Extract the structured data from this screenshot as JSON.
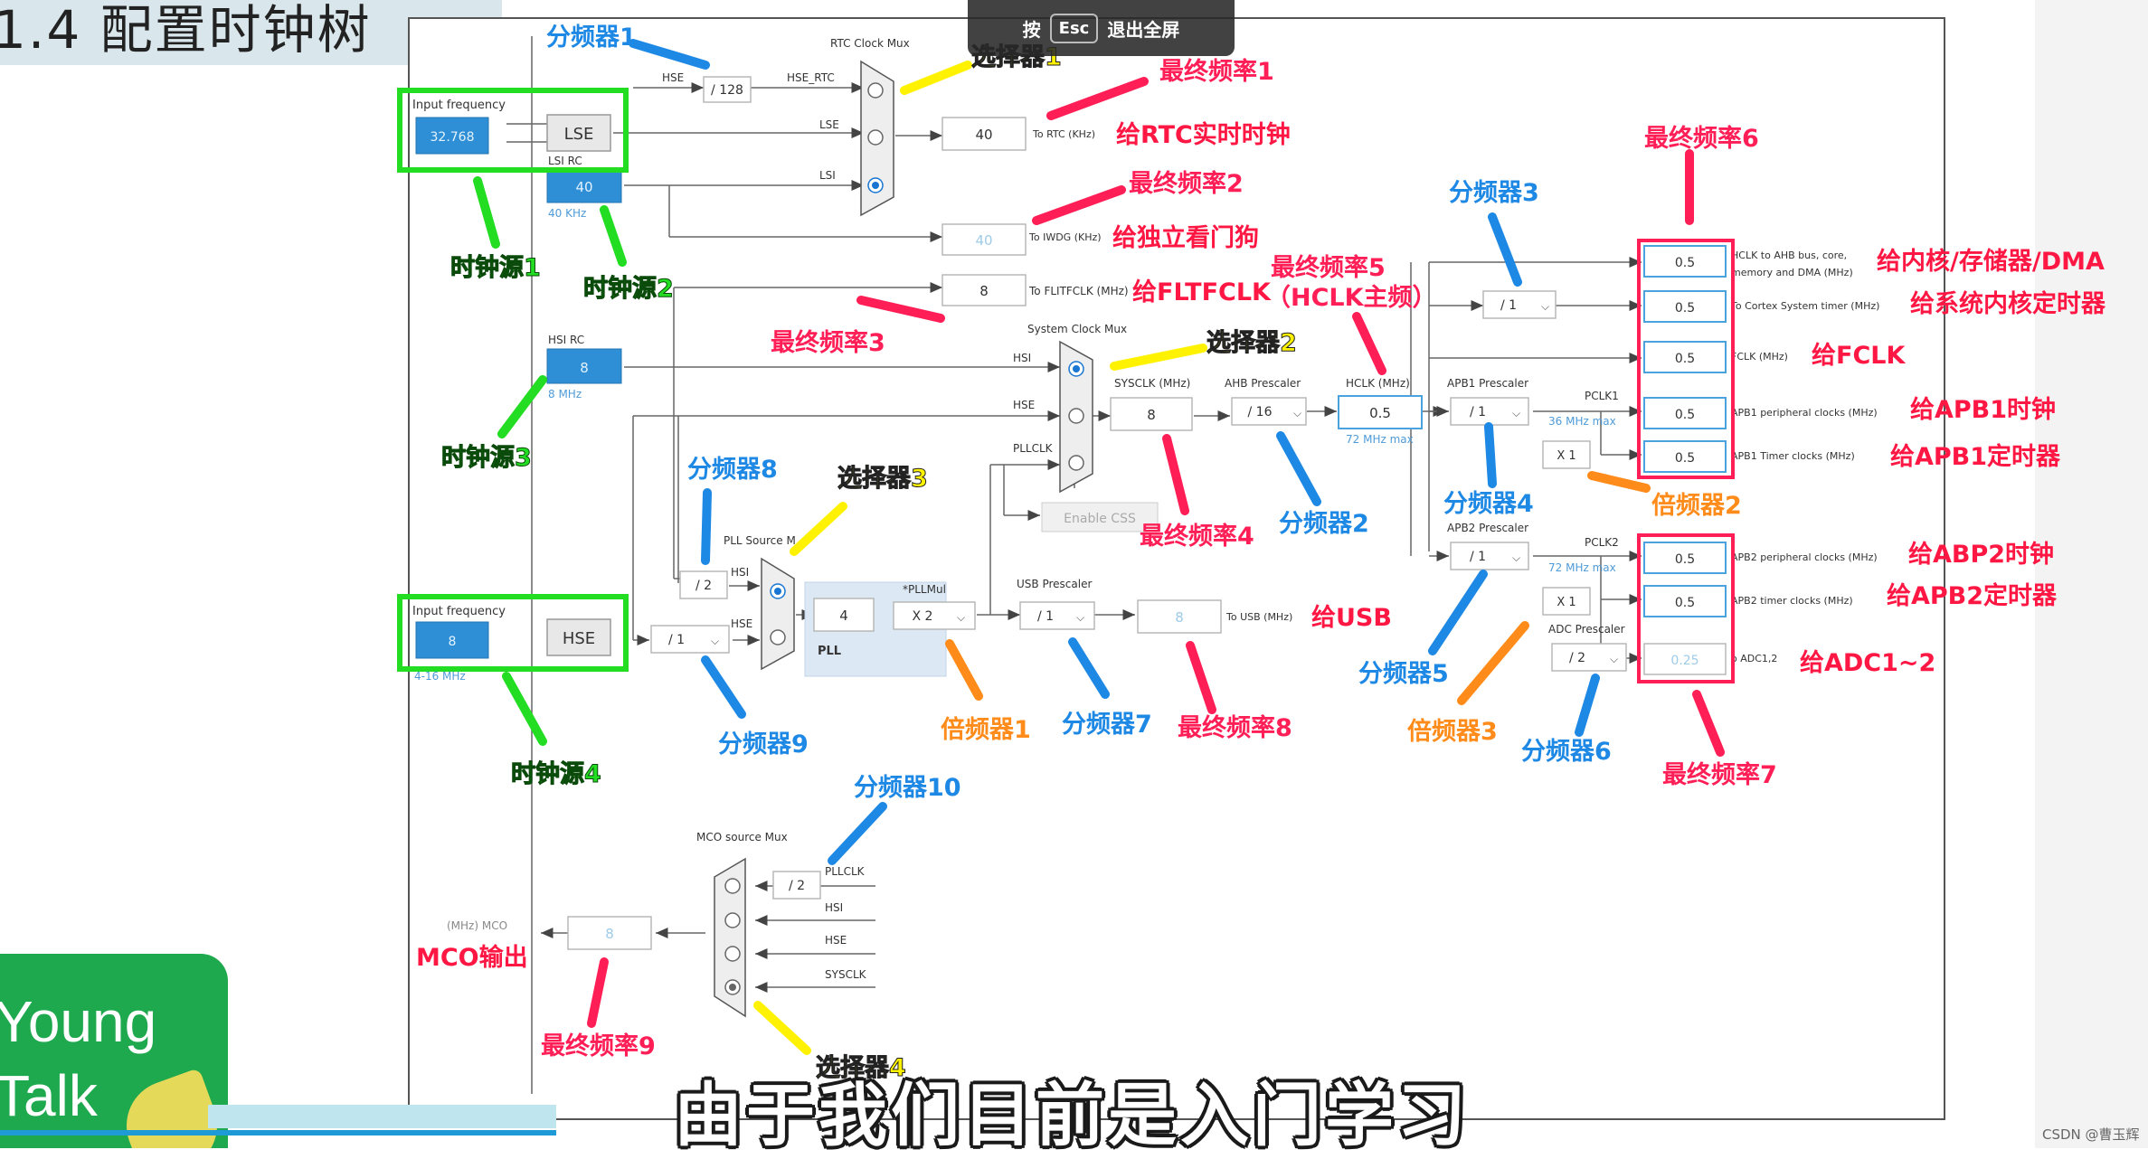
{
  "title": "1.4 配置时钟树",
  "overlay": {
    "key_label": "按",
    "key": "Esc",
    "text": "退出全屏"
  },
  "watermark": "CSDN @曹玉辉",
  "subtitle": "由于我们目前是入门学习",
  "logo": {
    "line1": "Young",
    "line2": "Talk"
  },
  "colors": {
    "green": "#22dd22",
    "red": "#ff1744",
    "blue": "#1e88e5",
    "yellow": "#fff200",
    "orange": "#ff8c1a",
    "pink": "#ff1e56",
    "source_blue": "#2e8fd6"
  },
  "diagram": {
    "input_frequency": "Input frequency",
    "lse_value": "32.768",
    "lse_label": "LSE",
    "lsi_rc": "LSI RC",
    "lsi_value": "40",
    "lsi_unit": "40 KHz",
    "hsi_rc": "HSI RC",
    "hsi_value": "8",
    "hsi_unit": "8 MHz",
    "hse_input_label": "Input frequency",
    "hse_value": "8",
    "hse_label": "HSE",
    "hse_range": "4-16 MHz",
    "rtc_mux_title": "RTC Clock Mux",
    "rtc_hse": "HSE",
    "rtc_div": "/ 128",
    "rtc_hse_rtc": "HSE_RTC",
    "rtc_lse": "LSE",
    "rtc_lsi": "LSI",
    "rtc_out": "40",
    "to_rtc": "To RTC (KHz)",
    "iwdg_out": "40",
    "to_iwdg": "To IWDG (KHz)",
    "flit_out": "8",
    "to_flit": "To FLITFCLK (MHz)",
    "sys_mux_title": "System Clock Mux",
    "sys_hsi": "HSI",
    "sys_hse": "HSE",
    "sys_pll": "PLLCLK",
    "enable_css": "Enable CSS",
    "sysclk_label": "SYSCLK (MHz)",
    "sysclk_value": "8",
    "ahb_label": "AHB Prescaler",
    "ahb_value": "/ 16",
    "hclk_label": "HCLK (MHz)",
    "hclk_value": "0.5",
    "hclk_max": "72 MHz max",
    "apb1_label": "APB1 Prescaler",
    "apb1_value": "/ 1",
    "pclk1": "PCLK1",
    "apb1_max": "36 MHz max",
    "apb1_mul": "X 1",
    "apb2_label": "APB2 Prescaler",
    "apb2_value": "/ 1",
    "pclk2": "PCLK2",
    "apb2_max": "72 MHz max",
    "apb2_mul": "X 1",
    "adc_label": "ADC Prescaler",
    "adc_value": "/ 2",
    "cortex_div": "/ 1",
    "pll_source_title": "PLL Source M",
    "pll_hsi": "HSI",
    "pll_hse": "HSE",
    "pll_div2": "/ 2",
    "hse_div": "/ 1",
    "pll_value": "4",
    "pll_mul_title": "*PLLMul",
    "pll_mul": "X 2",
    "pll_label": "PLL",
    "usb_label": "USB Prescaler",
    "usb_value": "/ 1",
    "usb_out": "8",
    "to_usb": "To USB (MHz)",
    "mco_mux_title": "MCO source Mux",
    "mco_pll": "PLLCLK",
    "mco_div": "/ 2",
    "mco_hsi": "HSI",
    "mco_hse": "HSE",
    "mco_sys": "SYSCLK",
    "mco_value": "8",
    "mco_label": "(MHz) MCO",
    "outputs": [
      {
        "value": "0.5",
        "label": "HCLK to AHB bus, core,"
      },
      {
        "value": "0.5",
        "label": "To Cortex System timer (MHz)"
      },
      {
        "value": "0.5",
        "label": "FCLK (MHz)"
      },
      {
        "value": "0.5",
        "label": "APB1 peripheral clocks (MHz)"
      },
      {
        "value": "0.5",
        "label": "APB1 Timer clocks (MHz)"
      },
      {
        "value": "0.5",
        "label": "APB2 peripheral clocks (MHz)"
      },
      {
        "value": "0.5",
        "label": "APB2 timer clocks (MHz)"
      },
      {
        "value": "0.25",
        "label": "o ADC1,2"
      }
    ],
    "hclk_sub": "memory and DMA (MHz)"
  },
  "annotations": {
    "div1": "分频器1",
    "sel1": "选择器1",
    "final1": "最终频率1",
    "rtc": "给RTC实时时钟",
    "final2": "最终频率2",
    "iwdg": "给独立看门狗",
    "flit": "给FLTFCLK",
    "final3": "最终频率3",
    "src1": "时钟源1",
    "src2": "时钟源2",
    "src3": "时钟源3",
    "src4": "时钟源4",
    "final5": "最终频率5",
    "final5b": "（HCLK主频）",
    "sel2": "选择器2",
    "final4": "最终频率4",
    "div2": "分频器2",
    "div3": "分频器3",
    "div4": "分频器4",
    "mul2": "倍频器2",
    "final6": "最终频率6",
    "core": "给内核/存储器/DMA",
    "systimer": "给系统内核定时器",
    "fclk": "给FCLK",
    "apb1clk": "给APB1时钟",
    "apb1tim": "给APB1定时器",
    "abp2clk": "给ABP2时钟",
    "apb2tim": "给APB2定时器",
    "adc": "给ADC1~2",
    "final7": "最终频率7",
    "div5": "分频器5",
    "mul3": "倍频器3",
    "div6": "分频器6",
    "div8": "分频器8",
    "sel3": "选择器3",
    "div9": "分频器9",
    "mul1": "倍频器1",
    "div7": "分频器7",
    "final8": "最终频率8",
    "usb": "给USB",
    "div10": "分频器10",
    "mco": "MCO输出",
    "final9": "最终频率9",
    "sel4": "选择器4"
  }
}
